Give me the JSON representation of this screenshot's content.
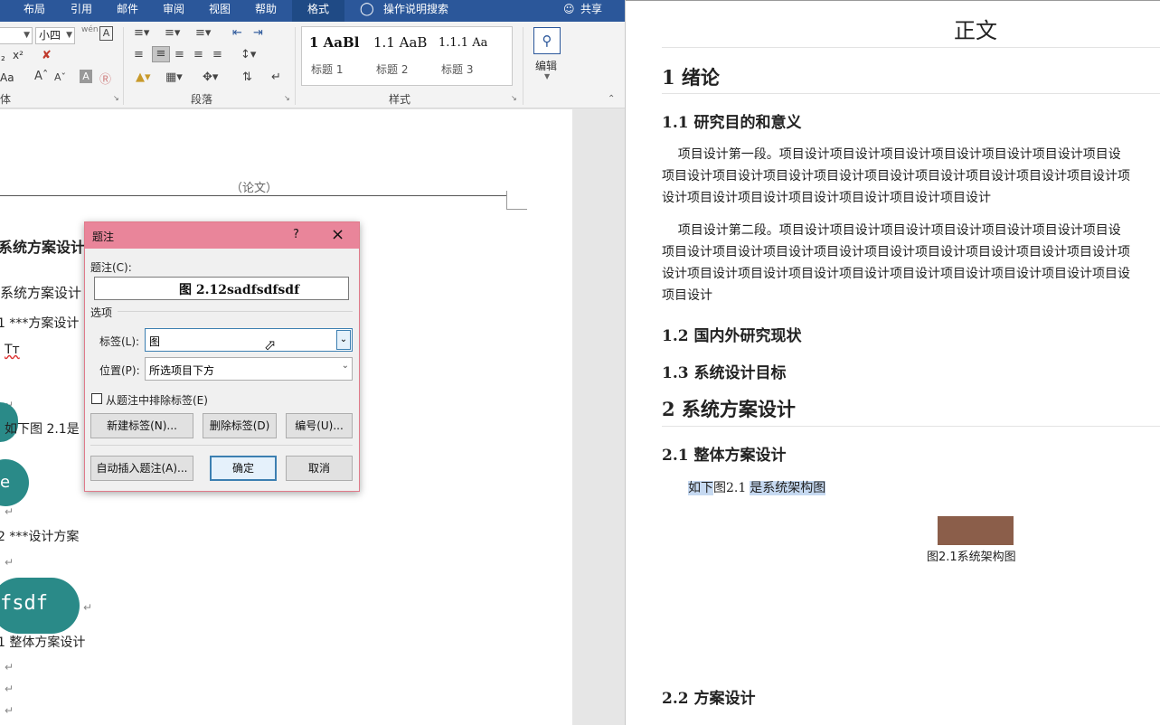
{
  "menubar": {
    "items": [
      "布局",
      "引用",
      "邮件",
      "审阅",
      "视图",
      "帮助",
      "格式"
    ],
    "active": "格式",
    "tell_me": "操作说明搜索",
    "share": "共享"
  },
  "ribbon": {
    "font_size": "小四",
    "font_group_label": "体",
    "paragraph_group_label": "段落",
    "styles_group_label": "样式",
    "editing_label": "编辑",
    "styles": [
      {
        "sample": "1 AaBl",
        "name": "标题 1"
      },
      {
        "sample": "1.1 AaB",
        "name": "标题 2"
      },
      {
        "sample": "1.1.1 Aa",
        "name": "标题 3"
      }
    ],
    "wen_label": "wén",
    "superscript": "x²",
    "aa_label": "Aa"
  },
  "doc_left": {
    "header": "（论文）",
    "lines": [
      "系统方案设计",
      "系统方案设计",
      "1 ***方案设计",
      "Tт",
      "如下图 2.1是",
      "e",
      "2 ***设计方案",
      "fsdf",
      "1 整体方案设计"
    ]
  },
  "dialog": {
    "title": "题注",
    "help": "?",
    "close": "×",
    "caption_label": "题注(C):",
    "caption_value": "图 2.12sadfsdfsdf",
    "options_label": "选项",
    "label_label": "标签(L):",
    "label_value": "图",
    "position_label": "位置(P):",
    "position_value": "所选项目下方",
    "exclude_label": "从题注中排除标签(E)",
    "new_label_btn": "新建标签(N)...",
    "delete_label_btn": "删除标签(D)",
    "numbering_btn": "编号(U)...",
    "autocaption_btn": "自动插入题注(A)...",
    "ok_btn": "确定",
    "cancel_btn": "取消"
  },
  "doc_right": {
    "title": "正文",
    "h1_1": "1 绪论",
    "h2_1_1": "1.1 研究目的和意义",
    "para1": "    项目设计第一段。项目设计项目设计项目设计项目设计项目设计项目设计项目设\n项目设计项目设计项目设计项目设计项目设计项目设计项目设计项目设计项目设计项\n设计项目设计项目设计项目设计项目设计项目设计项目设计",
    "para2": "    项目设计第二段。项目设计项目设计项目设计项目设计项目设计项目设计项目设\n项目设计项目设计项目设计项目设计项目设计项目设计项目设计项目设计项目设计项\n设计项目设计项目设计项目设计项目设计项目设计项目设计项目设计项目设计项目设\n项目设计",
    "h2_1_2": "1.2 国内外研究现状",
    "h2_1_3": "1.3 系统设计目标",
    "h1_2": "2 系统方案设计",
    "h2_2_1": "2.1 整体方案设计",
    "ref_a": "如下",
    "ref_b": "图2.1",
    "ref_c": "是系统架构图",
    "figure_color": "#8b5e4a",
    "figure_caption": "图2.1系统架构图",
    "h2_2_2": "2.2 方案设计"
  }
}
